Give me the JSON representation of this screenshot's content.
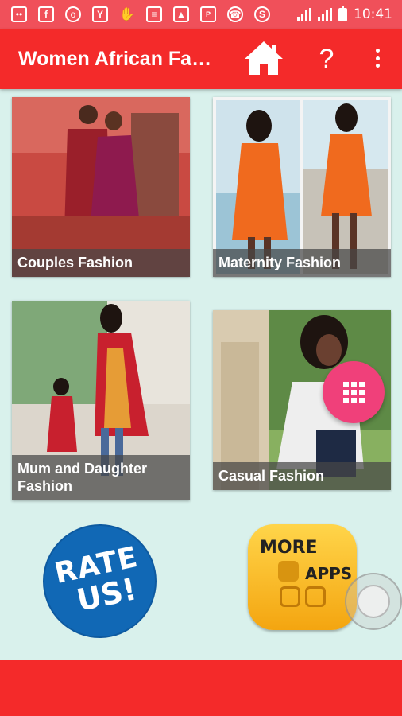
{
  "status_bar": {
    "time": "10:41",
    "icons": [
      "message-icon",
      "facebook-icon",
      "chrome-icon",
      "yelp-icon",
      "hand-icon",
      "chat-icon",
      "image-icon",
      "pdf-icon",
      "whatsapp-icon",
      "vpn-icon",
      "signal-icon",
      "battery-icon"
    ]
  },
  "app_bar": {
    "title": "Women African Fa…",
    "help_label": "?"
  },
  "categories": [
    {
      "label": "Couples Fashion"
    },
    {
      "label": "Maternity Fashion"
    },
    {
      "label": "Mum and Daughter Fashion"
    },
    {
      "label": "Casual Fashion"
    }
  ],
  "rate_us": {
    "line1": "RATE",
    "line2": "US!"
  },
  "more_apps": {
    "line1": "MORE",
    "line2": "APPS"
  },
  "colors": {
    "status_bar": "#f0505a",
    "app_bar": "#f42a2a",
    "background": "#d9f1ec",
    "fab": "#f0407a",
    "rate_us": "#1168b5",
    "more_apps": "#f9c02c"
  }
}
